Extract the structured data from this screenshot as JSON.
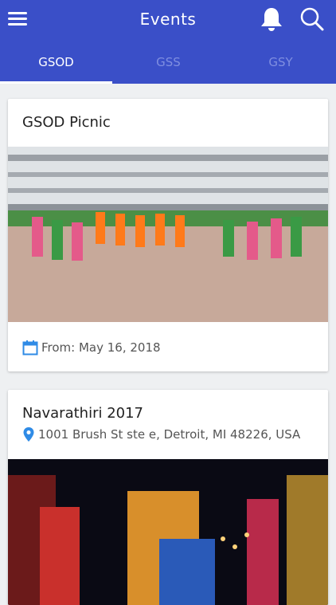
{
  "header": {
    "title": "Events",
    "menu_icon": "hamburger-menu-icon",
    "bell_icon": "bell-icon",
    "search_icon": "search-icon",
    "background": "#3a4fc8"
  },
  "tabs": [
    {
      "label": "GSOD",
      "active": true
    },
    {
      "label": "GSS",
      "active": false
    },
    {
      "label": "GSY",
      "active": false
    }
  ],
  "events": [
    {
      "title": "GSOD Picnic",
      "date_text": "From: May 16, 2018",
      "date_icon": "calendar-icon"
    },
    {
      "title": "Navarathiri 2017",
      "location_text": "1001 Brush St ste e, Detroit, MI 48226, USA",
      "location_icon": "map-pin-icon"
    }
  ],
  "colors": {
    "accent": "#3a4fc8",
    "icon_blue": "#2f8be6",
    "background": "#eef0f2"
  }
}
